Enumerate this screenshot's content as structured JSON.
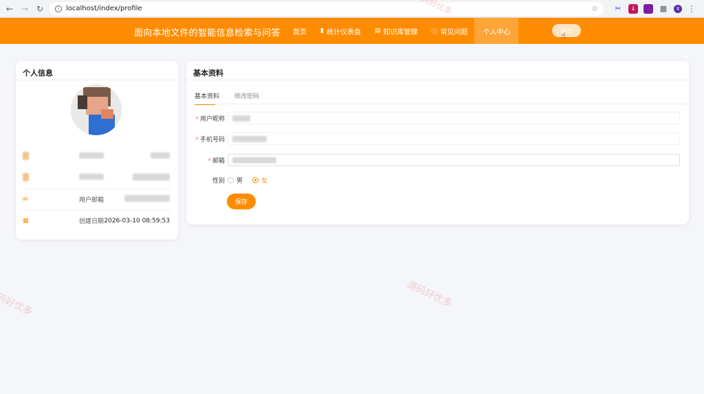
{
  "browser": {
    "url": "localhost/index/profile",
    "profile_initial": "X"
  },
  "header": {
    "app_title": "面向本地文件的智能信息检索与问答",
    "nav": [
      {
        "label": "首页",
        "icon": ""
      },
      {
        "label": "统计仪表盘",
        "icon": "bar-chart-icon"
      },
      {
        "label": "知识库管理",
        "icon": "document-icon"
      },
      {
        "label": "常见问题",
        "icon": "question-icon"
      },
      {
        "label": "个人中心",
        "icon": ""
      }
    ],
    "active_nav": "个人中心",
    "logout_label": "退出",
    "accent_color": "#ff8c00"
  },
  "profile_card": {
    "title": "个人信息",
    "rows": [
      {
        "icon": "user-icon",
        "label": "",
        "value": ""
      },
      {
        "icon": "phone-icon",
        "label": "",
        "value": ""
      },
      {
        "icon": "mail-icon",
        "label": "用户邮箱",
        "value": ""
      },
      {
        "icon": "calendar-icon",
        "label": "创建日期",
        "value": "2026-03-10 08:59:53"
      }
    ]
  },
  "settings_card": {
    "title": "基本资料",
    "tabs": [
      "基本资料",
      "修改密码"
    ],
    "active_tab": "基本资料",
    "fields": [
      {
        "label": "用户昵称",
        "required": true,
        "value": ""
      },
      {
        "label": "手机号码",
        "required": true,
        "value": ""
      },
      {
        "label": "邮箱",
        "required": true,
        "value": ""
      }
    ],
    "gender": {
      "label": "性别",
      "options": [
        "男",
        "女"
      ],
      "selected": "女"
    },
    "save_label": "保存"
  },
  "watermark": "源码好优多"
}
